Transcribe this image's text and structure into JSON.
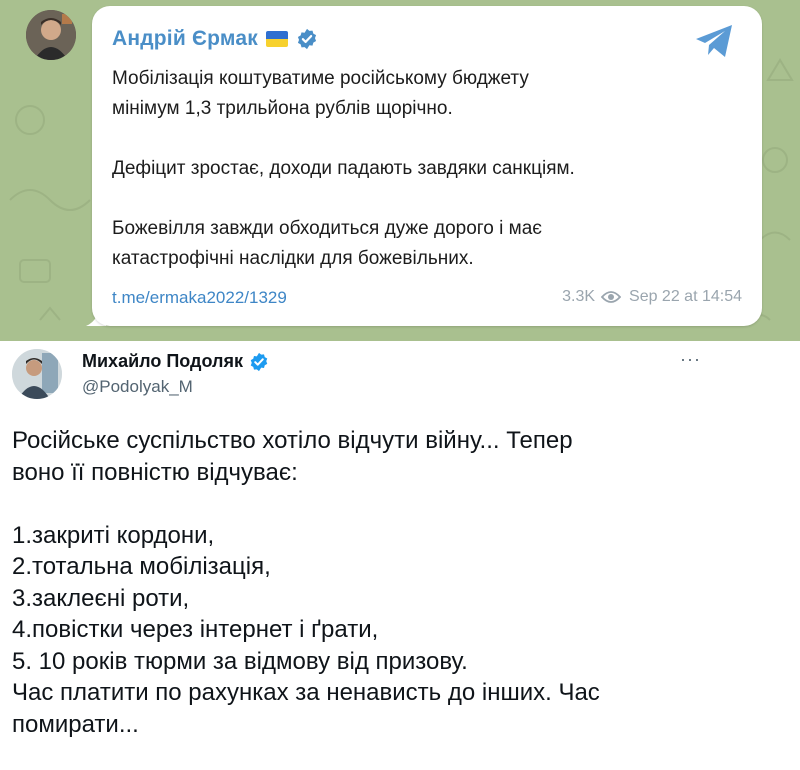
{
  "telegram": {
    "author": "Андрій Єрмак",
    "message_lines": [
      "Мобілізація коштуватиме російському бюджету",
      "мінімум 1,3 трильйона рублів щорічно.",
      "",
      "Дефіцит зростає, доходи падають завдяки санкціям.",
      "",
      "Божевілля завжди обходиться дуже дорого і має",
      "катастрофічні наслідки для божевільних."
    ],
    "link": "t.me/ermaka2022/1329",
    "views": "3.3K",
    "timestamp": "Sep 22 at 14:54",
    "icons": {
      "flag": "ukraine-flag-icon",
      "verified": "verified-icon",
      "share": "telegram-send-icon",
      "views": "eye-icon"
    },
    "colors": {
      "name": "#4a8ec7",
      "link": "#3e86c6",
      "background": "#a9c08f",
      "flag_blue": "#2f6fd0",
      "flag_yellow": "#f7d12e"
    }
  },
  "tweet": {
    "author": "Михайло Подоляк",
    "handle": "@Podolyak_M",
    "more": "···",
    "text_lines": [
      "Російське суспільство хотіло відчути війну... Тепер",
      "воно її повністю відчуває:",
      "",
      "1.закриті кордони,",
      "2.тотальна мобілізація,",
      "3.заклеєні роти,",
      "4.повістки через інтернет і ґрати,",
      "5. 10 років тюрми за відмову від призову.",
      "Час платити по рахунках за ненависть до інших. Час",
      "помирати..."
    ],
    "icons": {
      "verified": "verified-icon",
      "more": "more-icon"
    },
    "colors": {
      "verified": "#1d9bf0",
      "handle": "#536471"
    }
  }
}
